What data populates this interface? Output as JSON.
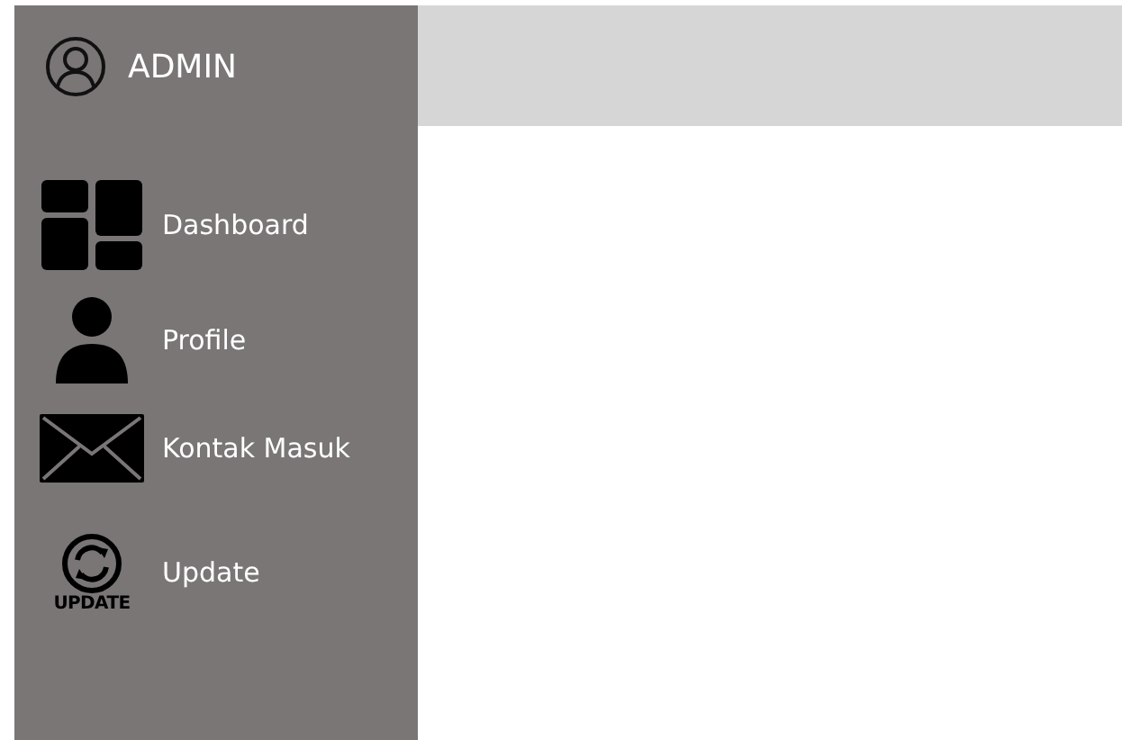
{
  "sidebar": {
    "user": {
      "name": "ADMIN"
    },
    "items": [
      {
        "kind": "dashboard",
        "label": "Dashboard"
      },
      {
        "kind": "profile",
        "label": "Profile"
      },
      {
        "kind": "mail",
        "label": "Kontak Masuk"
      },
      {
        "kind": "update",
        "label": "Update",
        "icon_text": "UPDATE"
      }
    ]
  }
}
